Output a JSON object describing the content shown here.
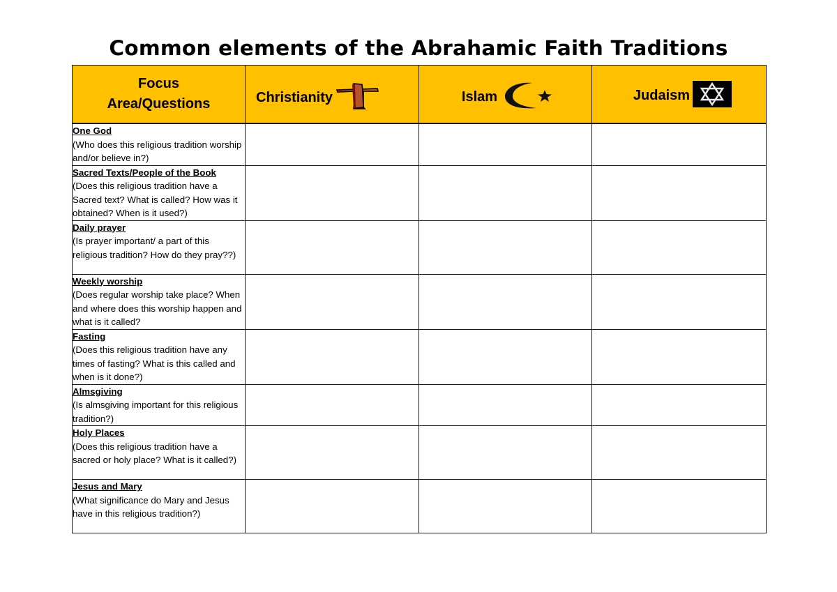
{
  "document": {
    "title": "Common elements of the Abrahamic Faith Traditions"
  },
  "table": {
    "header": {
      "focus_line1": "Focus",
      "focus_line2": "Area/Questions",
      "columns": [
        {
          "label": "Christianity",
          "icon": "cross-icon"
        },
        {
          "label": "Islam",
          "icon": "crescent-star-icon"
        },
        {
          "label": "Judaism",
          "icon": "star-of-david-icon"
        }
      ],
      "header_color": "#ffc000"
    },
    "rows": [
      {
        "title": "One God",
        "question": "(Who does this religious tradition worship and/or believe in?)",
        "christianity": "",
        "islam": "",
        "judaism": ""
      },
      {
        "title": "Sacred Texts/People of the Book",
        "question": "(Does this religious tradition have a Sacred text? What is called? How was it obtained? When is it used?)",
        "christianity": "",
        "islam": "",
        "judaism": ""
      },
      {
        "title": "Daily prayer",
        "question": "(Is prayer important/ a part of this religious tradition? How do they pray??)",
        "christianity": "",
        "islam": "",
        "judaism": ""
      },
      {
        "title": "Weekly worship",
        "question": "(Does regular worship take place? When and where does this worship happen and what is it called?",
        "christianity": "",
        "islam": "",
        "judaism": ""
      },
      {
        "title": "Fasting",
        "question": "(Does this religious tradition have any times of fasting? What is this called and when is it done?)",
        "christianity": "",
        "islam": "",
        "judaism": ""
      },
      {
        "title": "Almsgiving",
        "question": "(Is almsgiving important for this religious tradition?)",
        "christianity": "",
        "islam": "",
        "judaism": ""
      },
      {
        "title": "Holy Places",
        "question": "(Does this religious tradition have a sacred or holy place? What is it called?)",
        "christianity": "",
        "islam": "",
        "judaism": ""
      },
      {
        "title": "Jesus and Mary",
        "question": "(What significance do Mary and Jesus have in this religious tradition?)",
        "christianity": "",
        "islam": "",
        "judaism": ""
      }
    ]
  }
}
